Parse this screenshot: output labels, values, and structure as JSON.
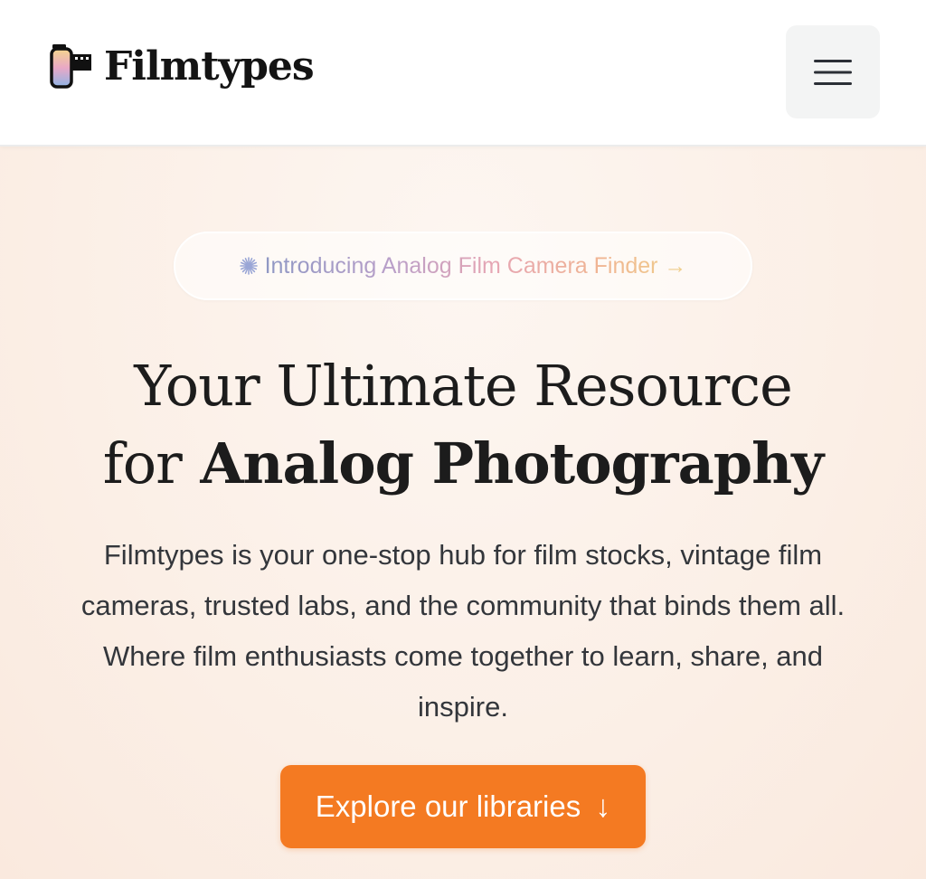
{
  "header": {
    "brand_name": "Filmtypes",
    "logo_icon": "film-canister-icon",
    "menu_icon": "hamburger-menu-icon"
  },
  "announcement": {
    "icon": "sparkle-icon",
    "text": "Introducing Analog Film Camera Finder →"
  },
  "hero": {
    "title_line1": "Your Ultimate Resource",
    "title_line2_prefix": "for",
    "title_line2_bold": "Analog Photography",
    "description": "Filmtypes is your one-stop hub for film stocks, vintage film cameras, trusted labs, and the community that binds them all. Where film enthusiasts come together to learn, share, and inspire."
  },
  "cta": {
    "label": "Explore our libraries",
    "arrow": "↓"
  },
  "colors": {
    "accent": "#f47a22",
    "text_dark": "#1c1c1c",
    "menu_bg": "#f3f4f4"
  }
}
